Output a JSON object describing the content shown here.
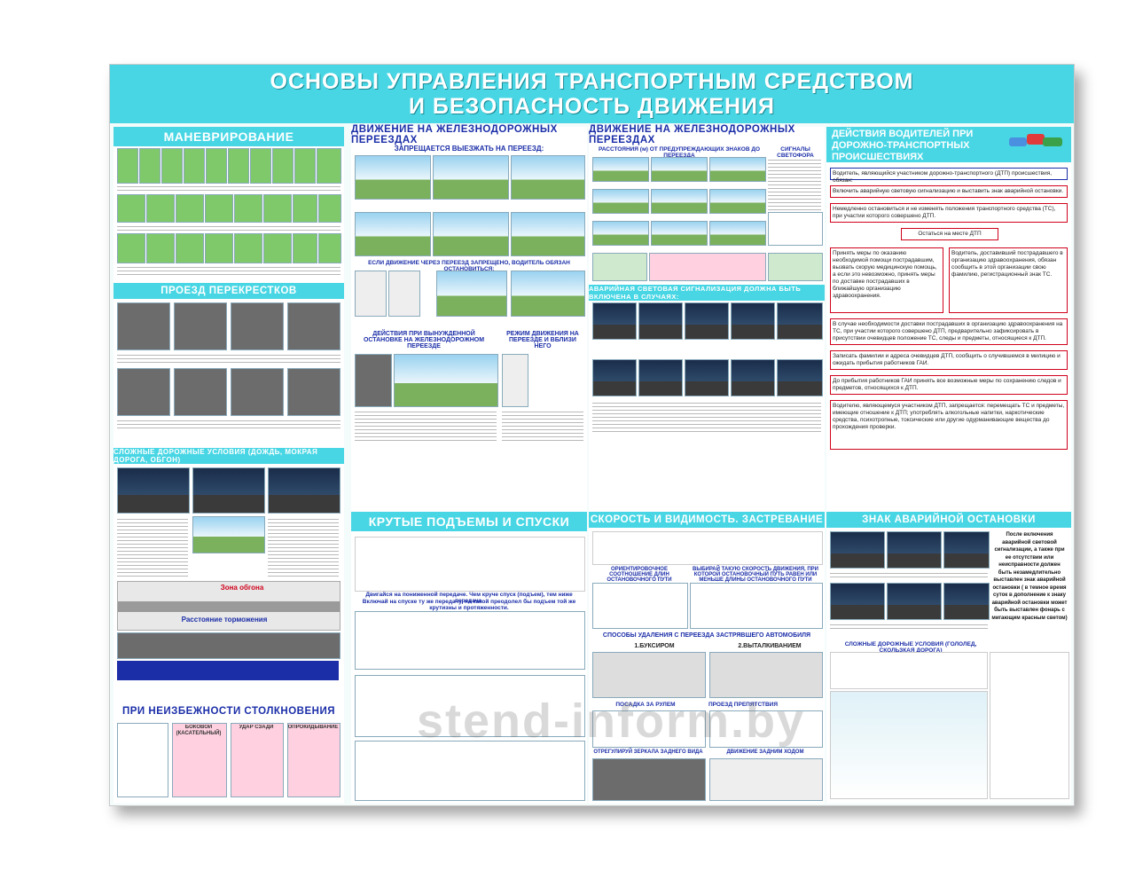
{
  "header": {
    "line1": "ОСНОВЫ УПРАВЛЕНИЯ ТРАНСПОРТНЫМ СРЕДСТВОМ",
    "line2": "И БЕЗОПАСНОСТЬ ДВИЖЕНИЯ"
  },
  "sections": {
    "maneuver": "МАНЕВРИРОВАНИЕ",
    "crossroads": "ПРОЕЗД ПЕРЕКРЕСТКОВ",
    "hard_conditions": "СЛОЖНЫЕ ДОРОЖНЫЕ УСЛОВИЯ (ДОЖДЬ, МОКРАЯ ДОРОГА, ОБГОН)",
    "collisions": "ПРИ НЕИЗБЕЖНОСТИ СТОЛКНОВЕНИЯ",
    "rail1": "ДВИЖЕНИЕ НА ЖЕЛЕЗНОДОРОЖНЫХ ПЕРЕЕЗДАХ",
    "rail2": "ДВИЖЕНИЕ НА ЖЕЛЕЗНОДОРОЖНЫХ ПЕРЕЕЗДАХ",
    "slopes": "КРУТЫЕ ПОДЪЕМЫ И СПУСКИ",
    "speed": "СКОРОСТЬ И ВИДИМОСТЬ. ЗАСТРЕВАНИЕ",
    "dtp": "ДЕЙСТВИЯ ВОДИТЕЛЕЙ ПРИ ДОРОЖНО-ТРАНСПОРТНЫХ ПРОИСШЕСТВИЯХ",
    "sign": "ЗНАК АВАРИЙНОЙ ОСТАНОВКИ",
    "ice": "СЛОЖНЫЕ ДОРОЖНЫЕ УСЛОВИЯ (ГОЛОЛЕД, СКОЛЬЗКАЯ ДОРОГА)"
  },
  "rail": {
    "forbidden": "ЗАПРЕЩАЕТСЯ ВЫЕЗЖАТЬ НА ПЕРЕЕЗД:",
    "if_forbidden": "ЕСЛИ ДВИЖЕНИЕ ЧЕРЕЗ ПЕРЕЕЗД ЗАПРЕЩЕНО, ВОДИТЕЛЬ ОБЯЗАН ОСТАНОВИТЬСЯ:",
    "forced_stop": "ДЕЙСТВИЯ ПРИ ВЫНУЖДЕННОЙ ОСТАНОВКЕ НА ЖЕЛЕЗНОДОРОЖНОМ ПЕРЕЕЗДЕ",
    "mode": "РЕЖИМ ДВИЖЕНИЯ НА ПЕРЕЕЗДЕ И ВБЛИЗИ НЕГО",
    "distances": "РАССТОЯНИЯ (м) ОТ ПРЕДУПРЕЖДАЮЩИХ ЗНАКОВ ДО ПЕРЕЕЗДА",
    "signals": "СИГНАЛЫ СВЕТОФОРА",
    "alarm": "АВАРИЙНАЯ СВЕТОВАЯ СИГНАЛИЗАЦИЯ ДОЛЖНА БЫТЬ ВКЛЮЧЕНА В СЛУЧАЯХ:"
  },
  "slopes": {
    "note1": "Двигайся на пониженной передаче. Чем круче спуск (подъем), тем ниже передача.",
    "note2": "Включай на спуске ту же передачу, на какой преодолел бы подъем той же крутизны и протяженности."
  },
  "speed": {
    "ratio": "ОРИЕНТИРОВОЧНОЕ СООТНОШЕНИЕ ДЛИН ОСТАНОВОЧНОГО ПУТИ",
    "choose": "ВЫБИРАЙ ТАКУЮ СКОРОСТЬ ДВИЖЕНИЯ, ПРИ КОТОРОЙ ОСТАНОВОЧНЫЙ ПУТЬ РАВЕН ИЛИ МЕНЬШЕ ДЛИНЫ ОСТАНОВОЧНОГО ПУТИ",
    "removal": "СПОСОБЫ УДАЛЕНИЯ С ПЕРЕЕЗДА ЗАСТРЯВШЕГО АВТОМОБИЛЯ",
    "tow": "1.БУКСИРОМ",
    "push": "2.ВЫТАЛКИВАНИЕМ",
    "seat": "ПОСАДКА ЗА РУЛЕМ",
    "obstacle": "ПРОЕЗД ПРЕПЯТСТВИЯ",
    "mirrors": "ОТРЕГУЛИРУЙ ЗЕРКАЛА ЗАДНЕГО ВИДА",
    "reverse": "ДВИЖЕНИЕ ЗАДНИМ ХОДОМ"
  },
  "maneuver_extra": {
    "overtake_zone": "Зона обгона",
    "dist": "Расстояние торможения"
  },
  "collisions": {
    "side": "БОКОВОЙ (КАСАТЕЛЬНЫЙ)",
    "rear": "УДАР СЗАДИ",
    "rollover": "ОПРОКИДЫВАНИЕ"
  },
  "dtp_steps": [
    "Водитель, являющийся участником дорожно-транспортного (ДТП) происшествия, обязан:",
    "Включить аварийную световую сигнализацию и выставить знак аварийной остановки.",
    "Немедленно остановиться и не изменять положения транспортного средства (ТС), при участии которого совершено ДТП.",
    "Остаться на месте ДТП",
    "Принять меры по оказанию необходимой помощи пострадавшим, вызвать скорую медицинскую помощь, а если это невозможно, принять меры по доставке пострадавших в ближайшую организацию здравоохранения.",
    "Водитель, доставивший пострадавшего в организацию здравоохранения, обязан сообщить в этой организации свою фамилию, регистрационный знак ТС.",
    "В случае необходимости доставки пострадавших в организацию здравоохранения на ТС, при участии которого совершено ДТП, предварительно зафиксировать в присутствии очевидцев положение ТС, следы и предметы, относящиеся к ДТП.",
    "Записать фамилии и адреса очевидцев ДТП, сообщить о случившемся в милицию и ожидать прибытия работников ГАИ.",
    "До прибытия работников ГАИ принять все возможные меры по сохранению следов и предметов, относящихся к ДТП.",
    "Водителю, являющемуся участником ДТП, запрещается: перемещать ТС и предметы, имеющие отношение к ДТП; употреблять алкогольные напитки, наркотические средства, психотропные, токсические или другие одурманивающие вещества до прохождения проверки."
  ],
  "sign_text": "После включения аварийной световой сигнализации, а также при ее отсутствии или неисправности должен быть незамедлительно выставлен знак аварийной остановки ( в темное время суток в дополнение к знаку аварийной остановки может быть выставлен фонарь с мигающим красным светом)",
  "watermark": "stend-inform.by"
}
